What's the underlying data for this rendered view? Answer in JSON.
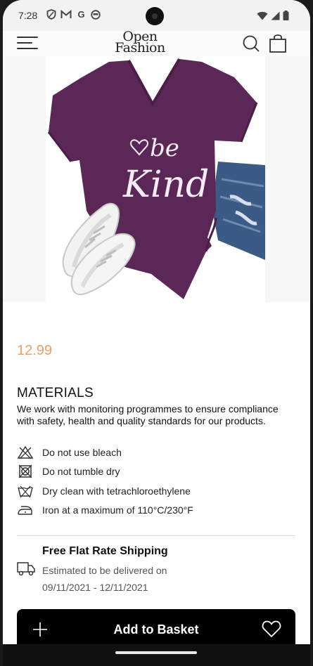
{
  "status_bar": {
    "time": "7:28",
    "icons": [
      "shield-icon",
      "gmail-icon",
      "google-icon",
      "face-icon"
    ],
    "right_icons": [
      "wifi-icon",
      "signal-icon",
      "battery-icon"
    ]
  },
  "header": {
    "logo_line1": "Open",
    "logo_line2": "Fashion",
    "menu_icon": "menu-icon",
    "search_icon": "search-icon",
    "bag_icon": "shopping-bag-icon"
  },
  "product": {
    "image_alt": "purple v-neck t-shirt with be kind print, sneakers and jeans",
    "print_line1": "be",
    "print_line2": "Kind",
    "price": "12.99",
    "colors": {
      "price": "#e8a06a",
      "shirt": "#5b2756"
    }
  },
  "materials": {
    "title": "MATERIALS",
    "description": "We work with monitoring programmes to ensure compliance with safety, health and quality standards for our products.",
    "care": [
      {
        "icon": "no-bleach-icon",
        "label": "Do not use bleach"
      },
      {
        "icon": "no-tumble-dry-icon",
        "label": "Do not tumble dry"
      },
      {
        "icon": "dry-clean-icon",
        "label": "Dry clean with tetrachloroethylene"
      },
      {
        "icon": "iron-icon",
        "label": "Iron at a maximum of 110°C/230°F"
      }
    ]
  },
  "shipping": {
    "title": "Free Flat Rate Shipping",
    "subtitle": "Estimated to be delivered on",
    "dates": "09/11/2021 - 12/11/2021",
    "icon": "truck-icon"
  },
  "bottom_bar": {
    "add_label": "Add to Basket",
    "plus_icon": "plus-icon",
    "heart_icon": "heart-icon"
  }
}
